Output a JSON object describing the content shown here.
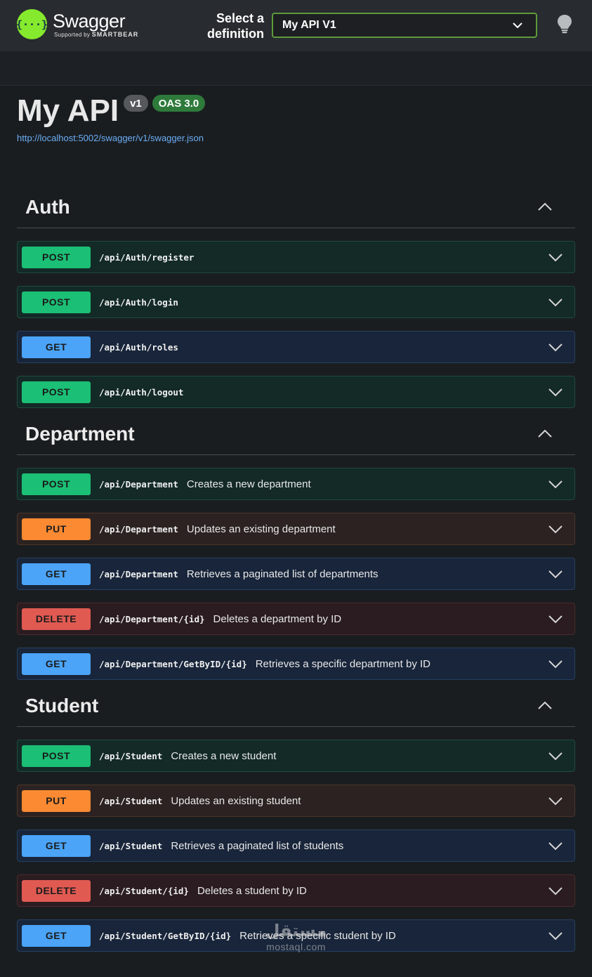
{
  "topbar": {
    "logo_glyph": "{···}",
    "logo_name": "Swagger",
    "logo_supported": "Supported by",
    "logo_brand": "SMARTBEAR",
    "select_label": "Select a definition",
    "selected_definition": "My API V1"
  },
  "info": {
    "title": "My API",
    "version": "v1",
    "oas": "OAS 3.0",
    "spec_url": "http://localhost:5002/swagger/v1/swagger.json"
  },
  "colors": {
    "post": "#1bbf75",
    "get": "#4ba4f8",
    "put": "#fb8a33",
    "delete": "#e05a52",
    "select_border": "#5e9a3a",
    "logo": "#85ea2d"
  },
  "sections": [
    {
      "title": "Auth",
      "ops": [
        {
          "method": "POST",
          "path": "/api/Auth/register",
          "summary": ""
        },
        {
          "method": "POST",
          "path": "/api/Auth/login",
          "summary": ""
        },
        {
          "method": "GET",
          "path": "/api/Auth/roles",
          "summary": ""
        },
        {
          "method": "POST",
          "path": "/api/Auth/logout",
          "summary": ""
        }
      ]
    },
    {
      "title": "Department",
      "ops": [
        {
          "method": "POST",
          "path": "/api/Department",
          "summary": "Creates a new department"
        },
        {
          "method": "PUT",
          "path": "/api/Department",
          "summary": "Updates an existing department"
        },
        {
          "method": "GET",
          "path": "/api/Department",
          "summary": "Retrieves a paginated list of departments"
        },
        {
          "method": "DELETE",
          "path": "/api/Department/{id}",
          "summary": "Deletes a department by ID"
        },
        {
          "method": "GET",
          "path": "/api/Department/GetByID/{id}",
          "summary": "Retrieves a specific department by ID"
        }
      ]
    },
    {
      "title": "Student",
      "ops": [
        {
          "method": "POST",
          "path": "/api/Student",
          "summary": "Creates a new student"
        },
        {
          "method": "PUT",
          "path": "/api/Student",
          "summary": "Updates an existing student"
        },
        {
          "method": "GET",
          "path": "/api/Student",
          "summary": "Retrieves a paginated list of students"
        },
        {
          "method": "DELETE",
          "path": "/api/Student/{id}",
          "summary": "Deletes a student by ID"
        },
        {
          "method": "GET",
          "path": "/api/Student/GetByID/{id}",
          "summary": "Retrieves a specific student by ID"
        }
      ]
    }
  ],
  "watermark": {
    "arabic": "مستقل",
    "latin": "mostaql.com"
  }
}
